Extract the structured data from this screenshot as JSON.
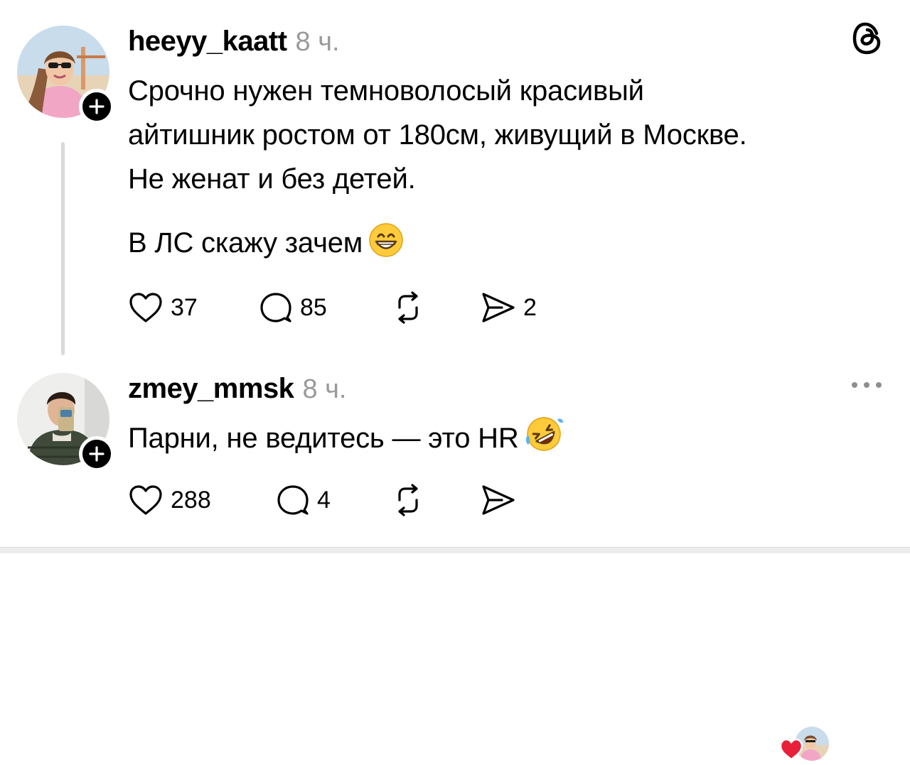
{
  "post1": {
    "username": "heeyy_kaatt",
    "timestamp": "8 ч.",
    "lines": [
      "Срочно нужен темноволосый красивый",
      "айтишник ростом от 180см, живущий в Москве.",
      "Не женат и без детей."
    ],
    "second_paragraph": "В ЛС скажу зачем",
    "emoji": "grinning-face",
    "likes": "37",
    "comments": "85",
    "reposts": "",
    "shares": "2"
  },
  "post2": {
    "username": "zmey_mmsk",
    "timestamp": "8 ч.",
    "text": "Парни, не ведитесь — это HR",
    "emoji": "rolling-on-floor-laughing",
    "likes": "288",
    "comments": "4",
    "reposts": "",
    "shares": ""
  },
  "icons": {
    "like": "heart-outline-icon",
    "comment": "speech-bubble-icon",
    "repost": "repost-arrows-icon",
    "share": "send-arrow-icon",
    "app": "threads-logo-icon",
    "more": "ellipsis-icon",
    "follow": "plus-icon"
  },
  "colors": {
    "text": "#000000",
    "muted": "#9a9a9a",
    "heart": "#e8203a",
    "thread_line": "#d9d9d9"
  }
}
